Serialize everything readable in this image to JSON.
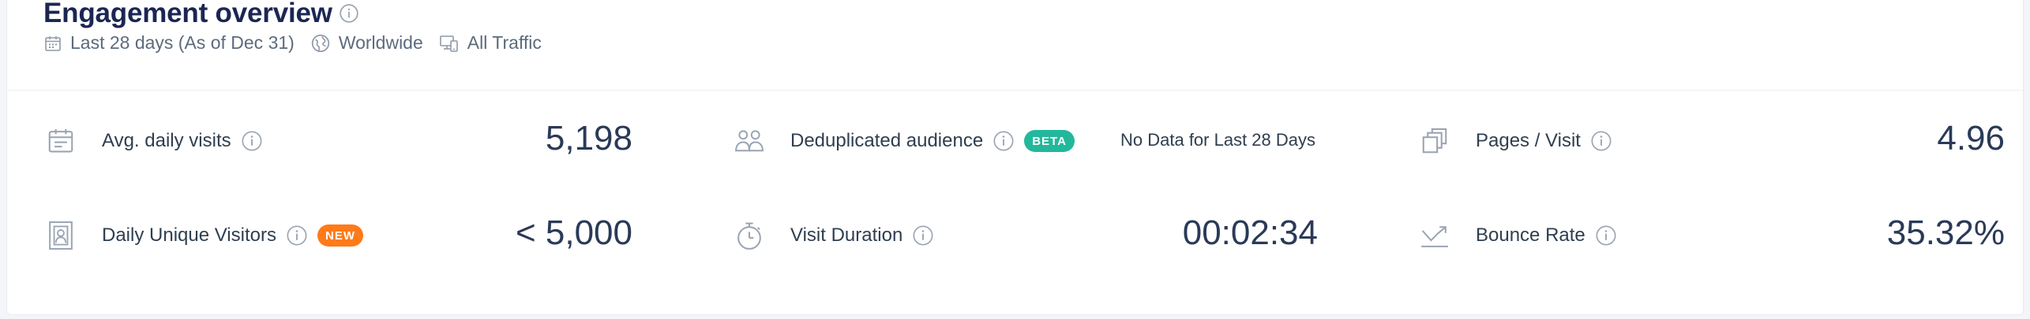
{
  "header": {
    "title": "Engagement overview",
    "date_range": "Last 28 days (As of Dec 31)",
    "region": "Worldwide",
    "traffic": "All Traffic"
  },
  "metrics": {
    "avg_daily_visits": {
      "label": "Avg. daily visits",
      "value": "5,198"
    },
    "dedup_audience": {
      "label": "Deduplicated audience",
      "badge": "BETA",
      "note": "No Data for Last 28 Days"
    },
    "pages_visit": {
      "label": "Pages / Visit",
      "value": "4.96"
    },
    "daily_unique": {
      "label": "Daily Unique Visitors",
      "badge": "NEW",
      "value": "< 5,000"
    },
    "visit_duration": {
      "label": "Visit Duration",
      "value": "00:02:34"
    },
    "bounce_rate": {
      "label": "Bounce Rate",
      "value": "35.32%"
    }
  },
  "colors": {
    "title": "#1b2653",
    "beta_badge": "#23b89b",
    "new_badge": "#ff7a19",
    "icon": "#9aa4b2"
  }
}
